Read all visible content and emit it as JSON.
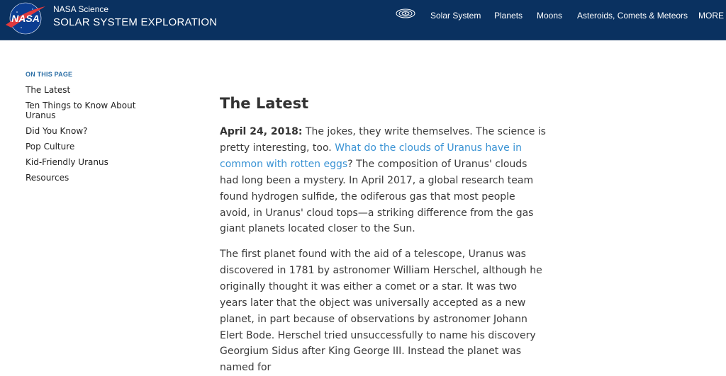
{
  "header": {
    "logo_text": "NASA",
    "brand_small": "NASA Science",
    "brand_big": "SOLAR SYSTEM EXPLORATION",
    "nav": [
      "Solar System",
      "Planets",
      "Moons",
      "Asteroids, Comets & Meteors",
      "MORE"
    ],
    "nav_icon": "galaxy-icon"
  },
  "sidebar": {
    "title": "ON THIS PAGE",
    "items": [
      "The Latest",
      "Ten Things to Know About Uranus",
      "Did You Know?",
      "Pop Culture",
      "Kid-Friendly Uranus",
      "Resources"
    ]
  },
  "main": {
    "title": "The Latest",
    "p1_date": "April 24, 2018:",
    "p1_text_a": " The jokes, they write themselves. The science is pretty interesting, too. ",
    "p1_link": "What do the clouds of Uranus have in common with rotten eggs",
    "p1_text_b": "? The composition of Uranus' clouds had long been a mystery. In April 2017, a global research team found hydrogen sulfide, the odiferous gas that most people avoid, in Uranus' cloud tops—a striking difference from the gas giant planets located closer to the Sun.",
    "p2": "The first planet found with the aid of a telescope, Uranus was discovered in 1781 by astronomer William Herschel, although he originally thought it was either a comet or a star. It was two years later that the object was universally accepted as a new planet, in part because of observations by astronomer Johann Elert Bode. Herschel tried unsuccessfully to name his discovery Georgium Sidus after King George III. Instead the planet was named for"
  },
  "colors": {
    "header_bg": "#0a3160",
    "link": "#3a93d4",
    "toc_title": "#2b6ea5"
  }
}
